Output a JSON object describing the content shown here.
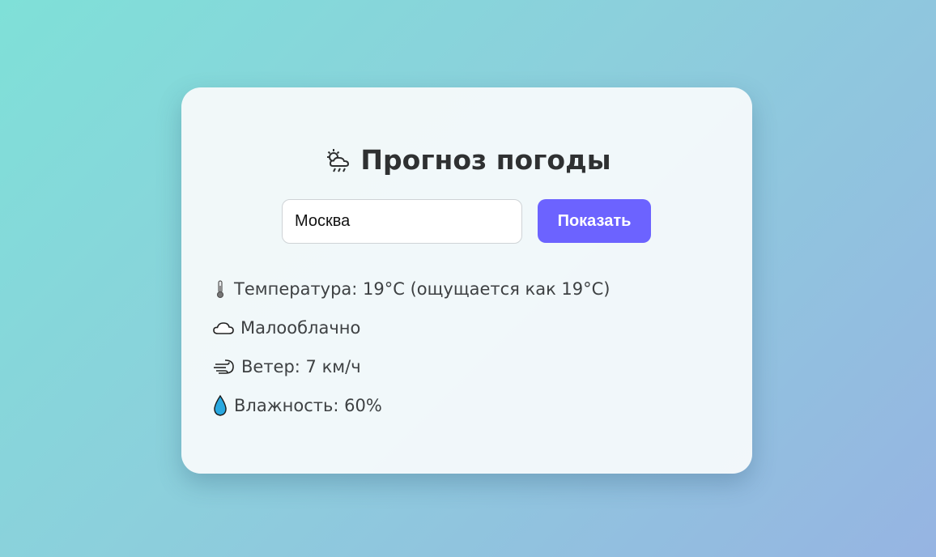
{
  "header": {
    "title": "Прогноз погоды",
    "title_icon": "cloud-sun-rain-icon"
  },
  "search": {
    "value": "Москва",
    "button_label": "Показать"
  },
  "weather": {
    "temperature_text": "Температура: 19°C (ощущается как 19°C)",
    "temperature_icon": "thermometer-icon",
    "condition_text": "Малооблачно",
    "condition_icon": "cloud-icon",
    "wind_text": "Ветер: 7 км/ч",
    "wind_icon": "wind-icon",
    "humidity_text": "Влажность: 60%",
    "humidity_icon": "droplet-icon"
  },
  "colors": {
    "accent": "#6c63ff",
    "background_start": "#7fe0d8",
    "background_end": "#96b4e2",
    "droplet": "#29a8e0"
  }
}
